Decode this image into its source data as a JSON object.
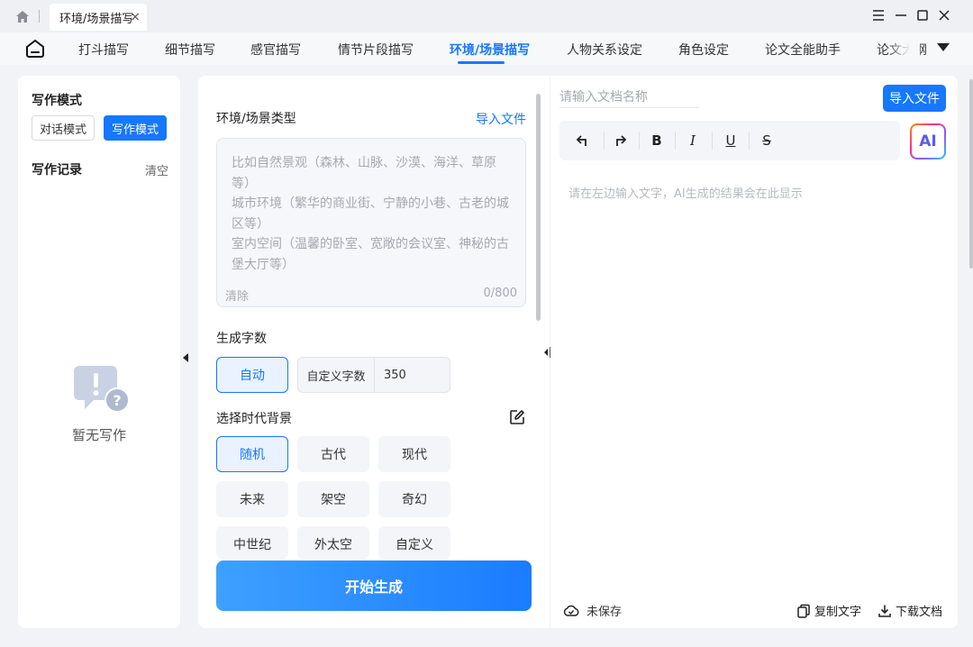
{
  "window": {
    "tab_title": "环境/场景描写",
    "tab_close": "×"
  },
  "nav": {
    "items": [
      "打斗描写",
      "细节描写",
      "感官描写",
      "情节片段描写",
      "环境/场景描写",
      "人物关系设定",
      "角色设定",
      "论文全能助手",
      "论文大纲"
    ],
    "active_index": 4
  },
  "left": {
    "mode_title": "写作模式",
    "mode_dialog": "对话模式",
    "mode_write": "写作模式",
    "records_title": "写作记录",
    "clear": "清空",
    "empty_text": "暂无写作"
  },
  "middle": {
    "type_label": "环境/场景类型",
    "import_file": "导入文件",
    "textarea_placeholder": "比如自然景观（森林、山脉、沙漠、海洋、草原等）\n城市环境（繁华的商业街、宁静的小巷、古老的城区等）\n室内空间（温馨的卧室、宽敞的会议室、神秘的古堡大厅等）",
    "textarea_clear": "清除",
    "char_count": "0/800",
    "word_count_label": "生成字数",
    "auto": "自动",
    "custom_count_label": "自定义字数",
    "custom_count_value": "350",
    "era_label": "选择时代背景",
    "eras": [
      "随机",
      "古代",
      "现代",
      "未来",
      "架空",
      "奇幻",
      "中世纪",
      "外太空",
      "自定义"
    ],
    "selected_era": "随机",
    "generate": "开始生成"
  },
  "right": {
    "doc_name_placeholder": "请输入文档名称",
    "import_btn": "导入文件",
    "ai_label": "AI",
    "tools": {
      "bold": "B",
      "italic": "I",
      "underline": "U",
      "strike": "S"
    },
    "hint": "请在左边输入文字，AI生成的结果会在此显示",
    "save_status": "未保存",
    "copy_text": "复制文字",
    "download": "下载文档"
  },
  "colors": {
    "accent": "#1677ff",
    "background": "#f1f3f7"
  }
}
